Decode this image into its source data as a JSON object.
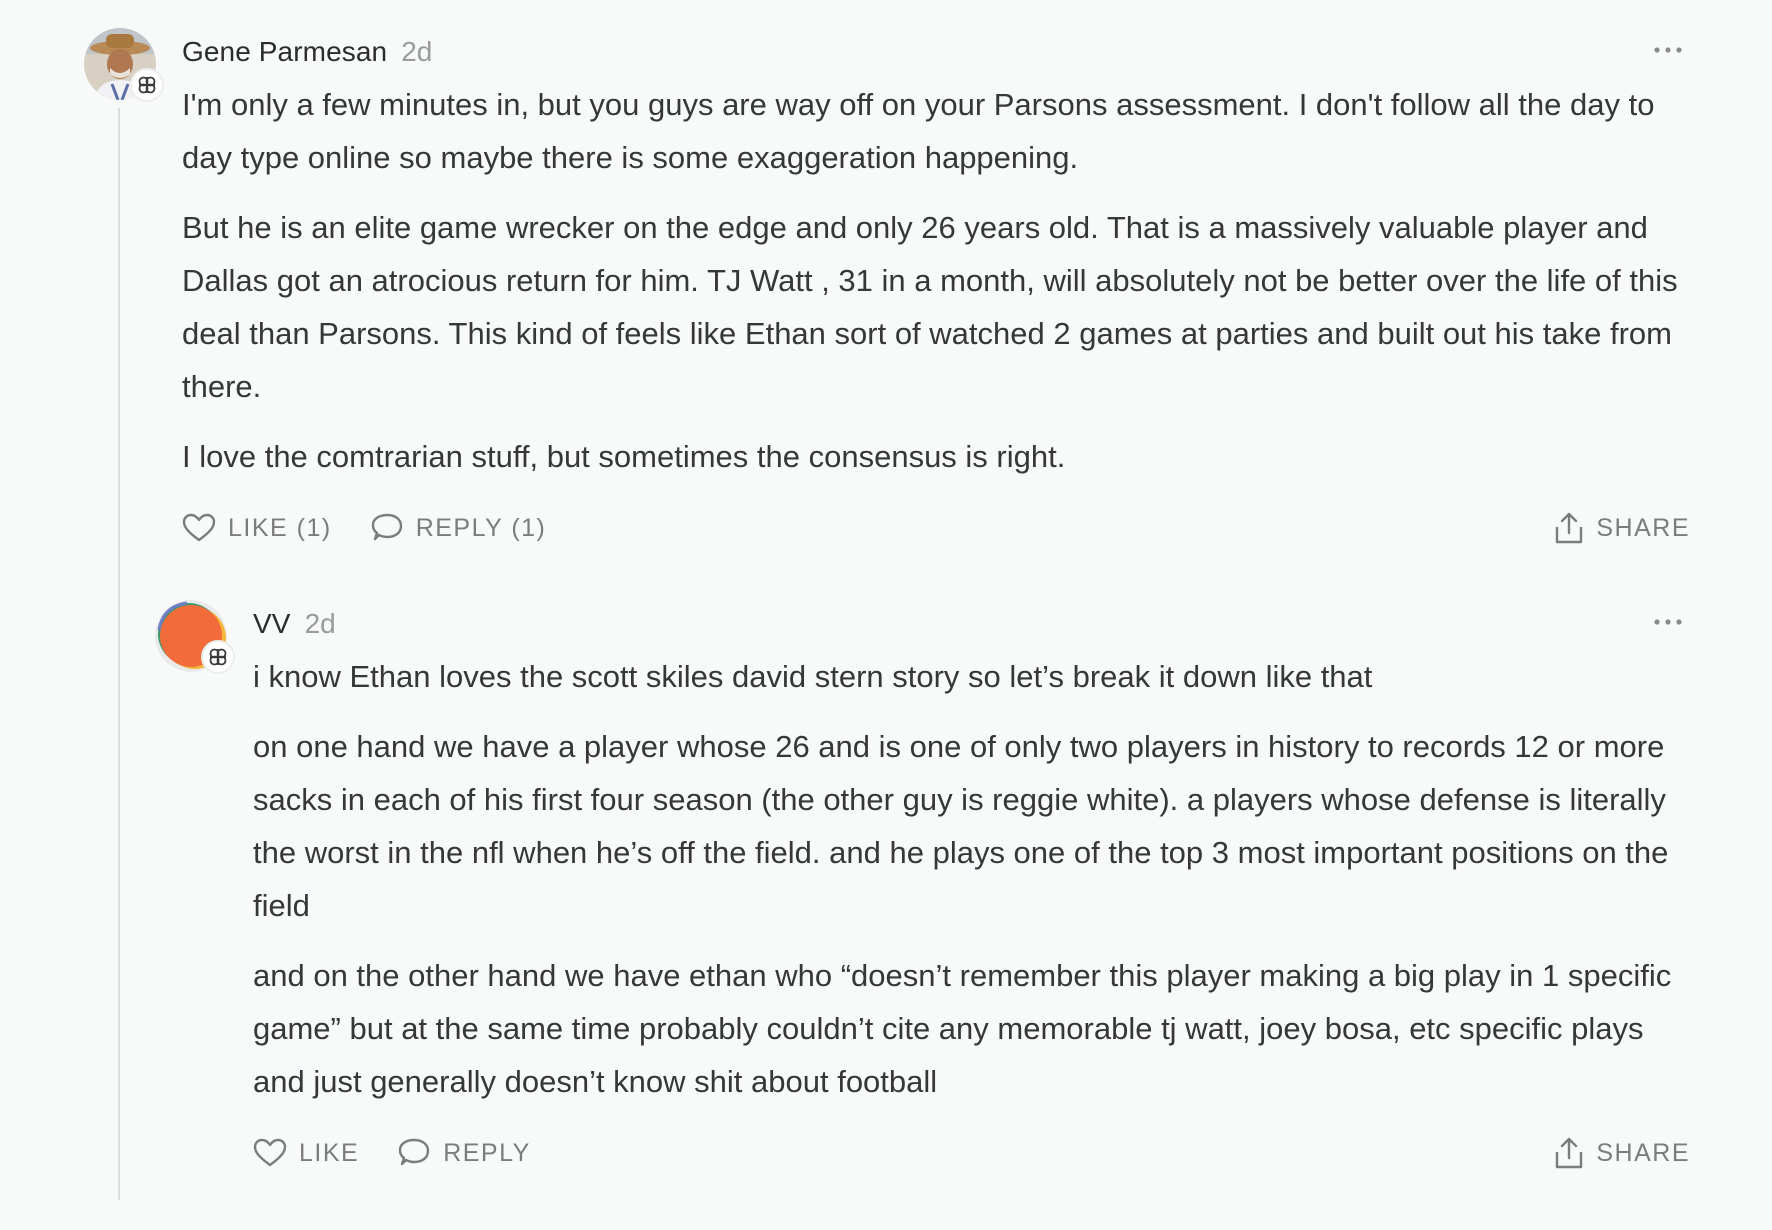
{
  "comments": [
    {
      "author": "Gene Parmesan",
      "time": "2d",
      "paragraphs": [
        "I'm only a few minutes in, but you guys are way off on your Parsons assessment. I don't follow all the day to day type online so maybe there is some exaggeration happening.",
        "But he is an elite game wrecker on the edge and only 26 years old. That is a massively valuable player and Dallas got an atrocious return for him. TJ Watt , 31 in a month, will absolutely not be better over the life of this deal than Parsons. This kind of feels like Ethan sort of watched 2 games at parties and built out his take from there.",
        "I love the comtrarian stuff, but sometimes the consensus is right."
      ],
      "like_label": "LIKE (1)",
      "reply_label": "REPLY (1)",
      "share_label": "SHARE"
    },
    {
      "author": "VV",
      "time": "2d",
      "paragraphs": [
        "i know Ethan loves the scott skiles david stern story so let’s break it down like that",
        "on one hand we have a player whose 26 and is one of only two players in history to records 12 or more sacks in each of his first four season (the other guy is reggie white). a players whose defense is literally the worst in the nfl when he’s off the field. and he plays one of the top 3 most important positions on the field",
        "and on the other hand we have ethan who “doesn’t remember this player making a big play in 1 specific game” but at the same time probably couldn’t cite any memorable tj watt, joey bosa, etc specific plays and just generally doesn’t know shit about football"
      ],
      "like_label": "LIKE",
      "reply_label": "REPLY",
      "share_label": "SHARE"
    }
  ],
  "icons": {
    "more": "more-horizontal-icon",
    "like": "heart-icon",
    "reply": "speech-bubble-icon",
    "share": "share-icon",
    "badge": "clover-badge-icon"
  },
  "colors": {
    "background": "#f8f9f9",
    "text": "#363737",
    "muted": "#7b7d7d",
    "avatar_orange": "#f26b3a"
  }
}
